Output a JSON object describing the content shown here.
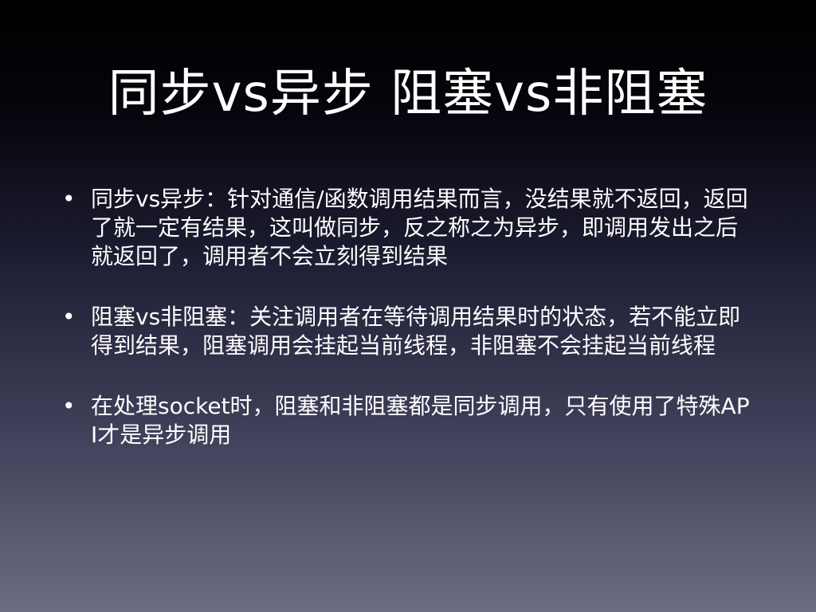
{
  "slide": {
    "title": "同步vs异步 阻塞vs非阻塞",
    "bullet_marker": "•",
    "bullets": [
      "同步vs异步：针对通信/函数调用结果而言，没结果就不返回，返回了就一定有结果，这叫做同步，反之称之为异步，即调用发出之后就返回了，调用者不会立刻得到结果",
      "阻塞vs非阻塞：关注调用者在等待调用结果时的状态，若不能立即得到结果，阻塞调用会挂起当前线程，非阻塞不会挂起当前线程",
      "在处理socket时，阻塞和非阻塞都是同步调用，只有使用了特殊API才是异步调用"
    ]
  }
}
